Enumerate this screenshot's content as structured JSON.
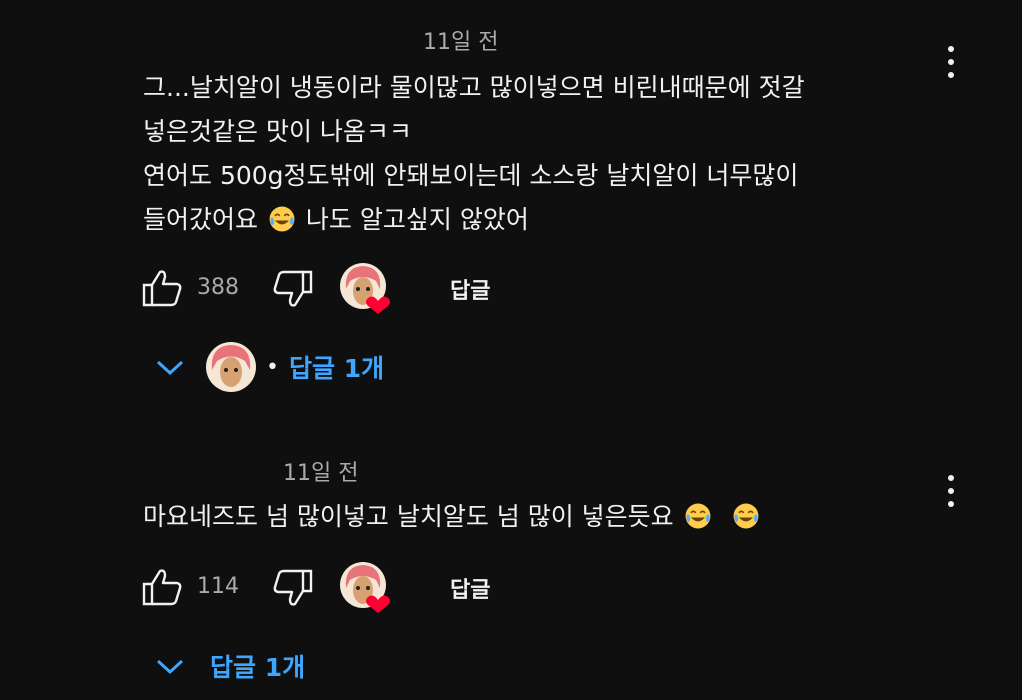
{
  "comments": [
    {
      "timestamp": "11일 전",
      "lines": [
        "그...날치알이 냉동이라 물이많고 많이넣으면 비린내때문에 젓갈",
        "넣은것같은 맛이 나옴ㅋㅋ",
        "연어도 500g정도밖에 안돼보이는데 소스랑 날치알이 너무많이",
        "들어갔어요",
        "나도 알고싶지 않았어"
      ],
      "emoji": "face-with-tears-of-joy",
      "like_count": "388",
      "reply_label": "답글",
      "replies_label": "답글 1개"
    },
    {
      "timestamp": "11일 전",
      "text": "마요네즈도 넘 많이넣고 날치알도 넘 많이 넣은듯요",
      "emoji": "face-with-tears-of-joy",
      "like_count": "114",
      "reply_label": "답글",
      "replies_label": "답글 1개"
    }
  ],
  "colors": {
    "background": "#0f0f0f",
    "text": "#f1f1f1",
    "secondary": "#aaaaaa",
    "link": "#3ea6ff",
    "heart": "#ff0033"
  }
}
